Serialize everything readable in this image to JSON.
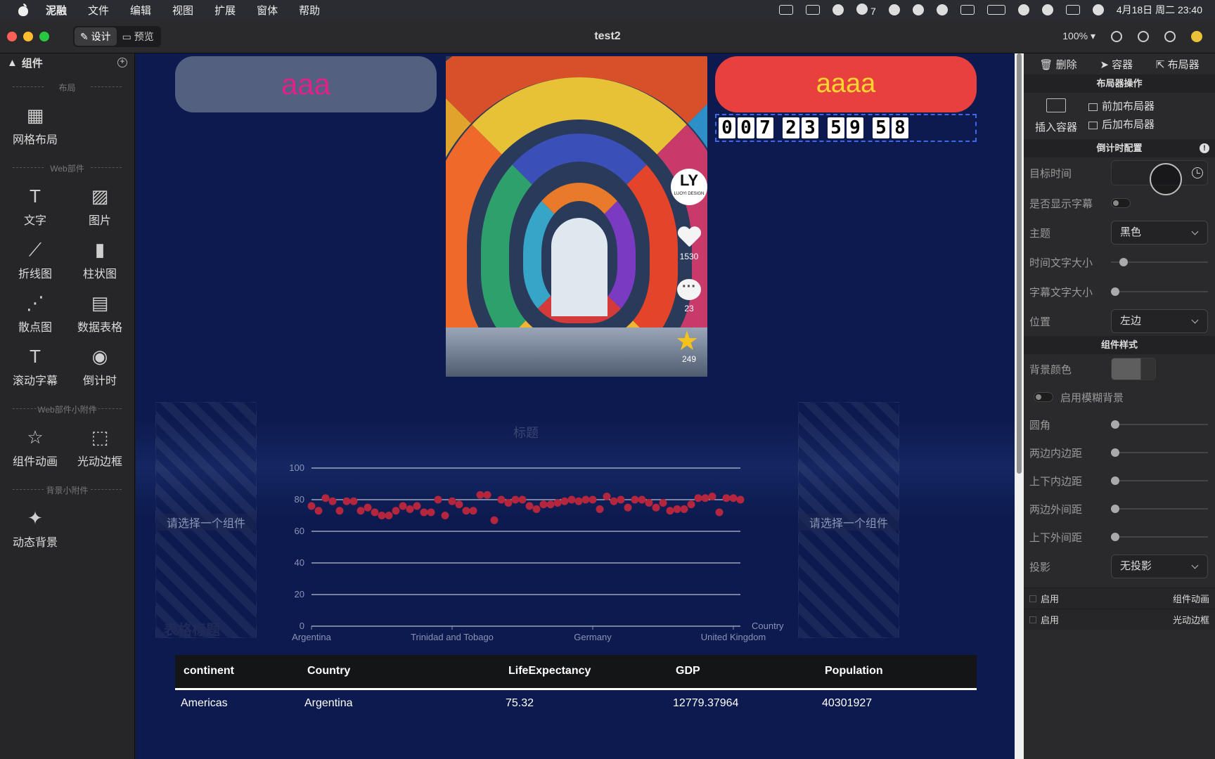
{
  "menubar": {
    "app_name": "泥融",
    "items": [
      "文件",
      "编辑",
      "视图",
      "扩展",
      "窗体",
      "帮助"
    ],
    "wechat_count": "7",
    "datetime": "4月18日 周二 23:40"
  },
  "window": {
    "title": "test2",
    "mode_design": "设计",
    "mode_preview": "预览",
    "zoom": "100%"
  },
  "left_panel": {
    "title": "组件",
    "sections": [
      {
        "label": "布局",
        "items": [
          {
            "label": "网格布局",
            "icon": "grid-layout-icon"
          }
        ]
      },
      {
        "label": "Web部件",
        "items": [
          {
            "label": "文字",
            "icon": "text-icon"
          },
          {
            "label": "图片",
            "icon": "image-icon"
          },
          {
            "label": "折线图",
            "icon": "line-chart-icon"
          },
          {
            "label": "柱状图",
            "icon": "bar-chart-icon"
          },
          {
            "label": "散点图",
            "icon": "scatter-chart-icon"
          },
          {
            "label": "数据表格",
            "icon": "table-icon"
          },
          {
            "label": "滚动字幕",
            "icon": "marquee-icon"
          },
          {
            "label": "倒计时",
            "icon": "stopwatch-icon"
          }
        ]
      },
      {
        "label": "Web部件小附件",
        "items": [
          {
            "label": "组件动画",
            "icon": "star-icon"
          },
          {
            "label": "光动边框",
            "icon": "border-icon"
          }
        ]
      },
      {
        "label": "背景小附件",
        "items": [
          {
            "label": "动态背景",
            "icon": "sparkle-icon"
          }
        ]
      }
    ]
  },
  "canvas": {
    "button_left": "aaa",
    "button_right": "aaaa",
    "countdown": {
      "days": "007",
      "hours": "23",
      "minutes": "59",
      "seconds": "58"
    },
    "photo": {
      "likes": "1530",
      "comments": "23",
      "stars": "249",
      "logo": "LY",
      "logo_sub": "LUOYI DESIGN"
    },
    "placeholder_text": "请选择一个组件",
    "table_title": "表格标题",
    "table": {
      "headers": [
        "continent",
        "Country",
        "LifeExpectancy",
        "GDP",
        "Population"
      ],
      "rows": [
        [
          "Americas",
          "Argentina",
          "75.32",
          "12779.37964",
          "40301927"
        ]
      ]
    }
  },
  "chart_data": {
    "type": "scatter",
    "title": "标题",
    "xlabel": "Country",
    "ylabel": "",
    "ylim": [
      0,
      100
    ],
    "yticks": [
      0,
      20,
      40,
      60,
      80,
      100
    ],
    "x_tick_labels": [
      "Argentina",
      "Trinidad and Tobago",
      "Germany",
      "United Kingdom"
    ],
    "point_color": "#b3263d",
    "values": [
      76,
      73,
      81,
      79,
      73,
      79,
      79,
      73,
      75,
      72,
      70,
      70,
      73,
      76,
      74,
      76,
      72,
      72,
      80,
      70,
      79,
      77,
      73,
      73,
      83,
      83,
      67,
      80,
      78,
      80,
      80,
      76,
      74,
      77,
      77,
      78,
      79,
      80,
      79,
      80,
      80,
      74,
      82,
      79,
      80,
      75,
      80,
      80,
      78,
      75,
      78,
      73,
      74,
      74,
      77,
      81,
      81,
      82,
      72,
      81,
      81,
      80
    ]
  },
  "right_panel": {
    "toolbar": {
      "delete": "删除",
      "container": "容器",
      "layouter": "布局器"
    },
    "layout_ops": {
      "title": "布局器操作",
      "insert": "插入容器",
      "prepend": "前加布局器",
      "append": "后加布局器"
    },
    "countdown_config": {
      "title": "倒计时配置",
      "target_time": "目标时间",
      "show_caption": "是否显示字幕",
      "theme": "主题",
      "theme_value": "黑色",
      "time_font_size": "时间文字大小",
      "caption_font_size": "字幕文字大小",
      "position": "位置",
      "position_value": "左边"
    },
    "style": {
      "title": "组件样式",
      "bg_color": "背景颜色",
      "blur_bg": "启用模糊背景",
      "radius": "圆角",
      "padding_h": "两边内边距",
      "padding_v": "上下内边距",
      "margin_h": "两边外间距",
      "margin_v": "上下外间距",
      "shadow": "投影",
      "shadow_value": "无投影"
    },
    "enable_rows": [
      {
        "left": "启用",
        "right": "组件动画"
      },
      {
        "left": "启用",
        "right": "光动边框"
      }
    ]
  }
}
